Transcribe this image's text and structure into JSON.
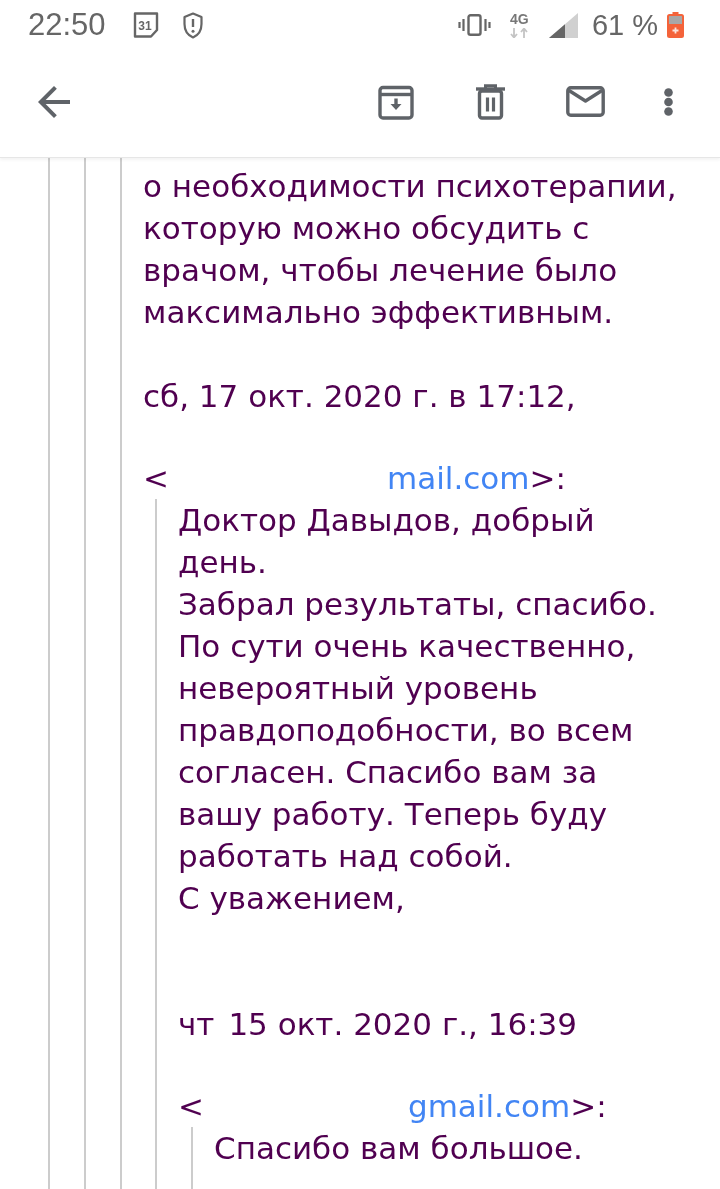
{
  "status_bar": {
    "time": "22:50",
    "calendar_day": "31",
    "network_type": "4G",
    "battery_percent": "61 %"
  },
  "thread": {
    "quote": {
      "quote": {
        "quote": {
          "paragraphs": [
            {
              "lines": [
                "о необходимости психотерапии,",
                "которую можно обсудить с",
                "врачом, чтобы лечение было",
                "максимально эффективным."
              ]
            }
          ],
          "reply_header": {
            "date_parts": [
              "сб, 17 окт. 2020 г. в 17:12,"
            ],
            "email_open": "<",
            "email_link": "mail.com",
            "email_close": ">:"
          },
          "quote": {
            "paragraphs": [
              {
                "lines": [
                  "Доктор Давыдов, добрый",
                  "день."
                ]
              },
              {
                "lines": [
                  "Забрал результаты, спасибо."
                ]
              },
              {
                "lines": [
                  "По сути очень качественно,",
                  "невероятный уровень",
                  "правдоподобности, во всем",
                  "согласен. Спасибо вам за",
                  "вашу работу. Теперь буду",
                  "работать над собой."
                ]
              },
              {
                "lines": [
                  "С уважением,"
                ]
              }
            ],
            "reply_header": {
              "date_parts": [
                "чт",
                "15 окт. 2020 г., 16:39"
              ],
              "email_open": "<",
              "email_link": "gmail.com",
              "email_close": ">:"
            },
            "quote": {
              "paragraphs": [
                {
                  "lines": [
                    "Спасибо вам большое."
                  ]
                }
              ]
            }
          }
        }
      }
    }
  }
}
